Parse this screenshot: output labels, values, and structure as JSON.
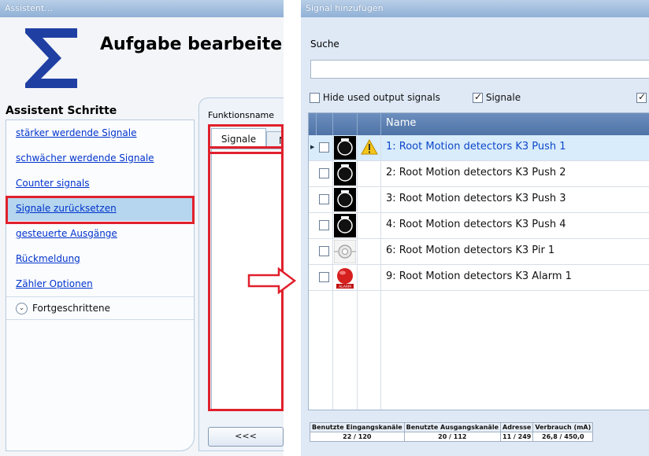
{
  "assistant": {
    "window_title": "Assistent...",
    "task_title": "Aufgabe bearbeiten",
    "steps_heading": "Assistent Schritte",
    "steps": [
      {
        "label": "stärker werdende Signale"
      },
      {
        "label": "schwächer werdende Signale"
      },
      {
        "label": "Counter signals"
      },
      {
        "label": "Signale zurücksetzen",
        "active": true
      },
      {
        "label": "gesteuerte Ausgänge"
      },
      {
        "label": "Rückmeldung"
      },
      {
        "label": "Zähler Optionen"
      }
    ],
    "advanced_label": "Fortgeschrittene",
    "function_name_label": "Funktionsname",
    "tab_signals": "Signale",
    "tab_next_partial": "N",
    "back_button": "<<<"
  },
  "signal_dialog": {
    "window_title": "Signal hinzufügen",
    "search_label": "Suche",
    "search_value": "",
    "options": {
      "hide_used": {
        "label": "Hide used output signals",
        "checked": false
      },
      "signals": {
        "label": "Signale",
        "checked": true
      },
      "third": {
        "checked": true
      }
    },
    "grid_column_name": "Name",
    "rows": [
      {
        "name": "1: Root Motion detectors K3 Push 1",
        "icon": "push-button-icon",
        "warning": true,
        "selected": true
      },
      {
        "name": "2: Root Motion detectors K3 Push 2",
        "icon": "push-button-icon",
        "warning": false,
        "selected": false
      },
      {
        "name": "3: Root Motion detectors K3 Push 3",
        "icon": "push-button-icon",
        "warning": false,
        "selected": false
      },
      {
        "name": "4: Root Motion detectors K3 Push 4",
        "icon": "push-button-icon",
        "warning": false,
        "selected": false
      },
      {
        "name": "6: Root Motion detectors K3 Pir 1",
        "icon": "pir-sensor-icon",
        "warning": false,
        "selected": false
      },
      {
        "name": "9: Root Motion detectors K3 Alarm 1",
        "icon": "alarm-icon",
        "warning": false,
        "selected": false
      }
    ],
    "footer": {
      "headers": [
        "Benutzte Eingangskanäle",
        "Benutzte Ausgangskanäle",
        "Adresse",
        "Verbrauch (mA)"
      ],
      "values": [
        "22 / 120",
        "20 / 112",
        "11 / 249",
        "26,8 / 450,0"
      ]
    }
  },
  "alarm_icon_text": "ALARM",
  "colors": {
    "highlight": "#e0202c",
    "selection": "#b5d6ee",
    "grid_header": "#5a7fb2",
    "link": "#0033cc"
  }
}
